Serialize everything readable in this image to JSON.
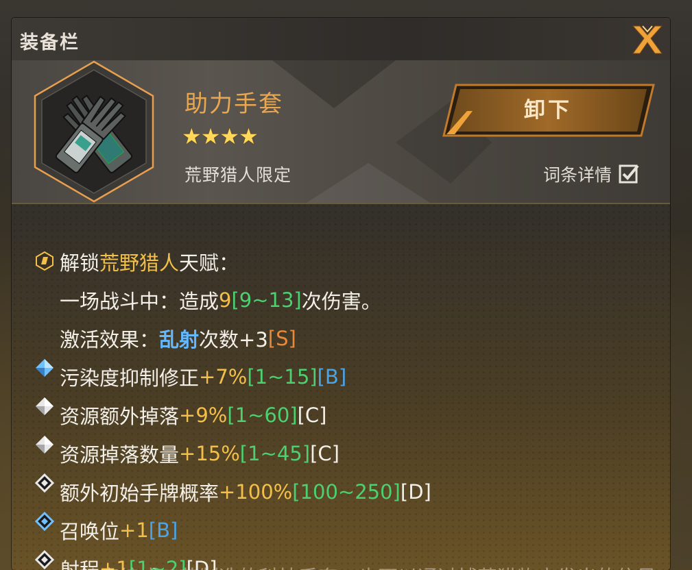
{
  "window": {
    "title": "装备栏",
    "close_icon": "close-x-icon"
  },
  "item": {
    "name": "助力手套",
    "rarity_stars": 4,
    "stars_text": "★★★★",
    "source": "荒野猎人限定",
    "icon": "gloves-icon"
  },
  "actions": {
    "unequip_label": "卸下",
    "detail_label": "词条详情",
    "detail_checked": true
  },
  "unlock": {
    "prefix": "解锁",
    "name": "荒野猎人",
    "suffix": "天赋：",
    "condition_prefix": "一场战斗中：造成",
    "condition_value": "9",
    "condition_range": "[9~13]",
    "condition_suffix": "次伤害。",
    "effect_prefix": "激活效果：",
    "effect_skill": "乱射",
    "effect_text": "次数+3",
    "effect_grade": "[S]"
  },
  "affixes": [
    {
      "name": "污染度抑制修正",
      "value": "+7%",
      "range": "[1~15]",
      "grade": "[B]",
      "grade_color": "blue",
      "icon": "diamond-blue-icon"
    },
    {
      "name": "资源额外掉落",
      "value": "+9%",
      "range": "[1~60]",
      "grade": "[C]",
      "grade_color": "white",
      "icon": "diamond-white-icon"
    },
    {
      "name": "资源掉落数量",
      "value": "+15%",
      "range": "[1~45]",
      "grade": "[C]",
      "grade_color": "white",
      "icon": "diamond-white-icon"
    },
    {
      "name": "额外初始手牌概率",
      "value": "+100%",
      "range": "[100~250]",
      "grade": "[D]",
      "grade_color": "white",
      "icon": "diamond-outline-icon"
    },
    {
      "name": "召唤位",
      "value": "+1",
      "range": "",
      "grade": "[B]",
      "grade_color": "blue",
      "icon": "diamond-outline-blue-icon"
    },
    {
      "name": "射程",
      "value": "+1",
      "range": "[1~2]",
      "grade": "[D]",
      "grade_color": "white",
      "icon": "diamond-outline-icon"
    }
  ],
  "footer_text": "由精密编成工艺制造的科技手套，也可以通过捕获猎物来发出的信号",
  "colors": {
    "accent": "#e9a850",
    "value_yellow": "#f2c04a",
    "range_green": "#4cd070",
    "grade_blue": "#4aa4e8",
    "grade_orange": "#e88a3a"
  }
}
